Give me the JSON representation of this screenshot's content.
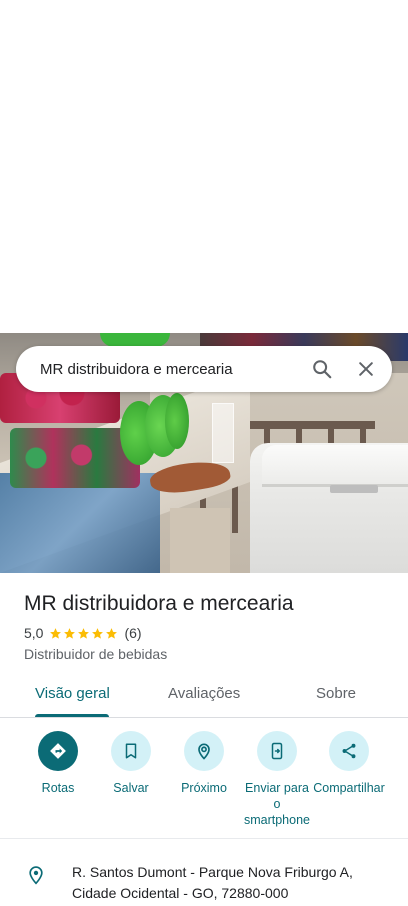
{
  "search": {
    "query": "MR distribuidora e mercearia",
    "search_icon": "search-icon",
    "close_icon": "close-icon"
  },
  "place": {
    "name": "MR distribuidora e mercearia",
    "rating": "5,0",
    "stars": 5,
    "reviews_count": "(6)",
    "category": "Distribuidor de bebidas"
  },
  "tabs": [
    {
      "label": "Visão geral",
      "active": true
    },
    {
      "label": "Avaliações",
      "active": false
    },
    {
      "label": "Sobre",
      "active": false
    }
  ],
  "actions": [
    {
      "label": "Rotas",
      "icon": "directions-icon"
    },
    {
      "label": "Salvar",
      "icon": "bookmark-icon"
    },
    {
      "label": "Próximo",
      "icon": "nearby-icon"
    },
    {
      "label": "Enviar para o smartphone",
      "icon": "send-to-phone-icon"
    },
    {
      "label": "Compartilhar",
      "icon": "share-icon"
    }
  ],
  "address": {
    "icon": "location-pin-icon",
    "line1": "R. Santos Dumont - Parque Nova Friburgo A,",
    "line2": "Cidade Ocidental - GO, 72880-000"
  },
  "colors": {
    "accent": "#0b6b76",
    "chip_bg": "#d3f1f7",
    "star": "#fbbc04"
  }
}
